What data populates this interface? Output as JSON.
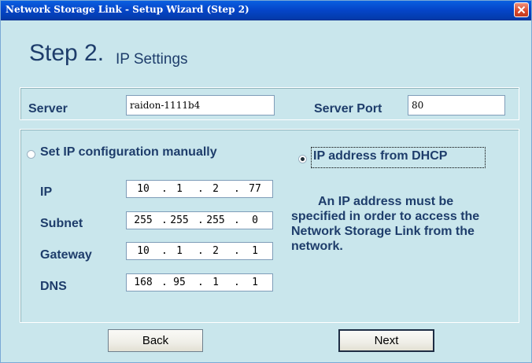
{
  "window": {
    "title": "Network Storage Link - Setup Wizard (Step 2)"
  },
  "heading": {
    "step": "Step 2.",
    "subtitle": "IP Settings"
  },
  "server": {
    "label": "Server",
    "value": "raidon-1111b4",
    "port_label": "Server Port",
    "port_value": "80"
  },
  "ip_config": {
    "manual_label": "Set IP configuration manually",
    "manual_selected": false,
    "dhcp_label": "IP address from DHCP",
    "dhcp_selected": true,
    "fields": [
      {
        "label": "IP",
        "octets": [
          "10",
          "1",
          "2",
          "77"
        ]
      },
      {
        "label": "Subnet",
        "octets": [
          "255",
          "255",
          "255",
          "0"
        ]
      },
      {
        "label": "Gateway",
        "octets": [
          "10",
          "1",
          "2",
          "1"
        ]
      },
      {
        "label": "DNS",
        "octets": [
          "168",
          "95",
          "1",
          "1"
        ]
      }
    ],
    "note_line1": "An IP address must be",
    "note_rest": "specified in order to access the Network Storage Link from the network."
  },
  "buttons": {
    "back": "Back",
    "next": "Next"
  },
  "colors": {
    "background": "#c9e6ec",
    "text": "#1e3d6b",
    "titlebar": "#0545c8",
    "close": "#d8472a"
  }
}
